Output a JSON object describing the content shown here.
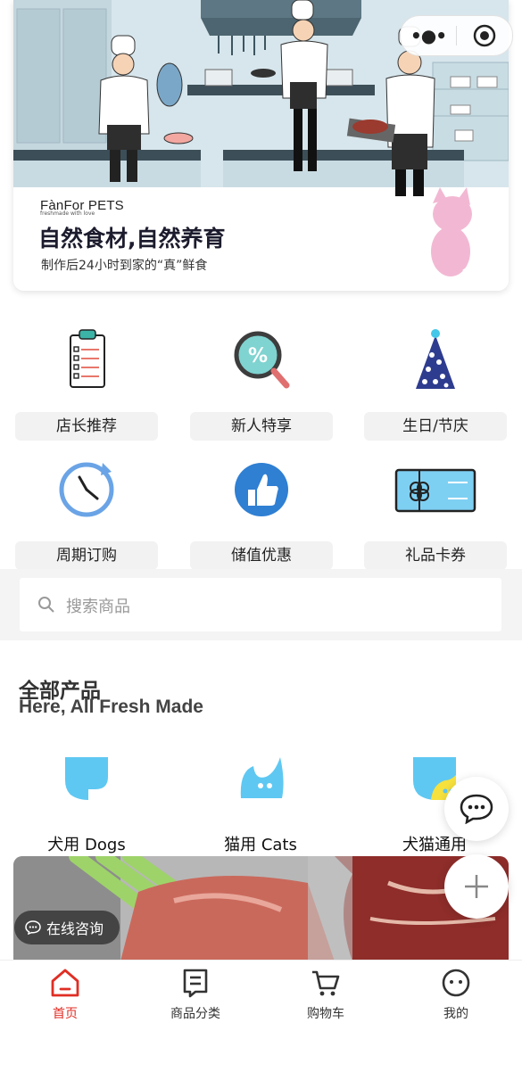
{
  "banner": {
    "brand": "FànFor PETS",
    "brand_tagline": "freshmade with love",
    "title": "自然食材,自然养育",
    "subtitle": "制作后24小时到家的“真”鲜食"
  },
  "features": [
    {
      "label": "店长推荐",
      "icon": "clipboard-icon"
    },
    {
      "label": "新人特享",
      "icon": "magnifier-percent-icon"
    },
    {
      "label": "生日/节庆",
      "icon": "party-hat-icon"
    },
    {
      "label": "周期订购",
      "icon": "clock-icon"
    },
    {
      "label": "储值优惠",
      "icon": "thumbs-up-icon"
    },
    {
      "label": "礼品卡券",
      "icon": "gift-card-icon"
    }
  ],
  "search": {
    "placeholder": "搜索商品"
  },
  "products": {
    "title": "全部产品",
    "subtitle": "Here, All Fresh Made",
    "categories": [
      {
        "label": "犬用 Dogs",
        "icon": "dog-icon"
      },
      {
        "label": "猫用 Cats",
        "icon": "cat-icon"
      },
      {
        "label": "犬猫通用",
        "icon": "dog-cat-icon"
      }
    ]
  },
  "consult": {
    "label": "在线咨询"
  },
  "tabbar": [
    {
      "label": "首页",
      "icon": "home-icon",
      "active": true
    },
    {
      "label": "商品分类",
      "icon": "category-list-icon",
      "active": false
    },
    {
      "label": "购物车",
      "icon": "cart-icon",
      "active": false
    },
    {
      "label": "我的",
      "icon": "profile-icon",
      "active": false
    }
  ],
  "colors": {
    "accent": "#e02e24",
    "brand_blue": "#5ec8f2",
    "brand_yellow": "#f6e13d"
  }
}
